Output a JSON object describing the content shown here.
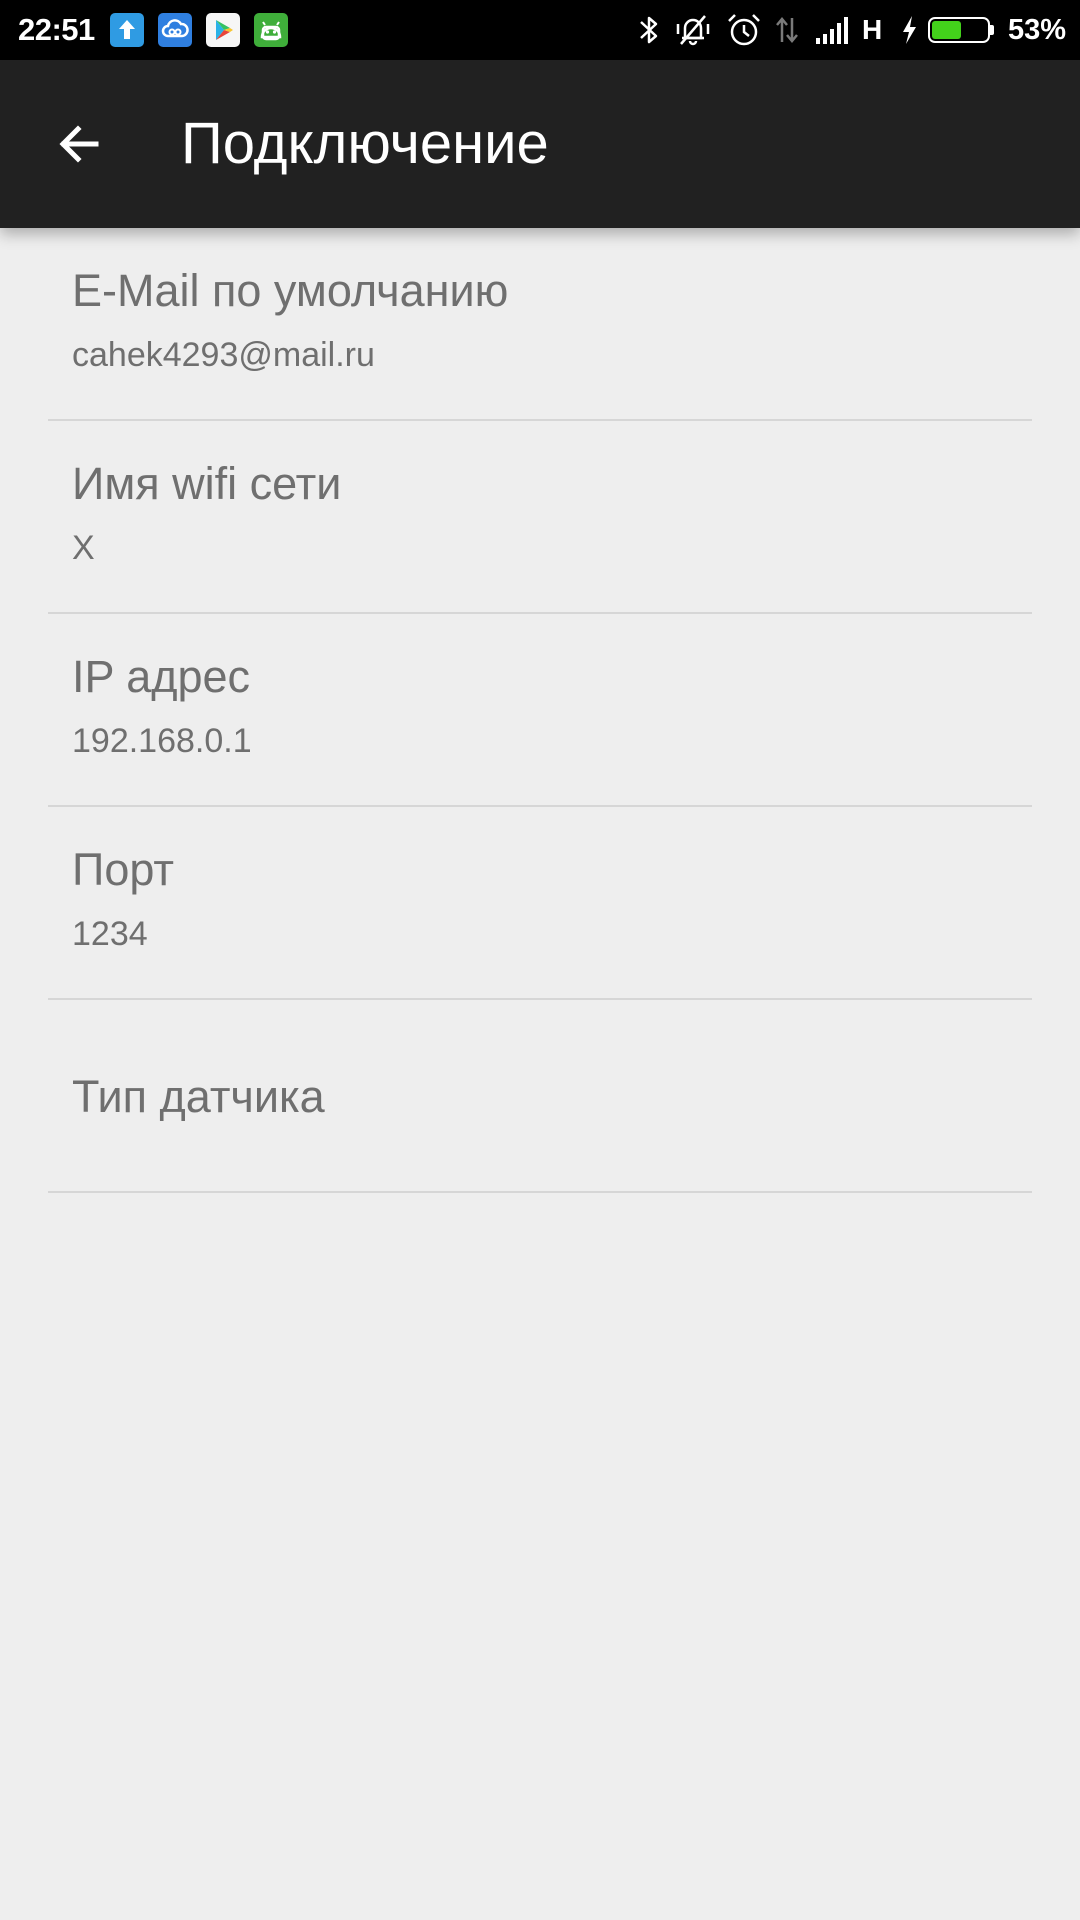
{
  "status_bar": {
    "time": "22:51",
    "network_type": "H",
    "battery_percent": "53%",
    "battery_level": 0.53,
    "notification_icons": [
      "upload-icon",
      "cloud-icon",
      "play-store-icon",
      "android-icon"
    ],
    "system_icons": [
      "bluetooth-icon",
      "silent-mode-icon",
      "alarm-icon",
      "data-activity-icon",
      "signal-icon",
      "charging-icon",
      "battery-icon"
    ],
    "battery_fill_color": "#43d11b"
  },
  "app_bar": {
    "back_icon": "arrow-back-icon",
    "title": "Подключение",
    "background": "#212121"
  },
  "settings": [
    {
      "title": "E-Mail по умолчанию",
      "summary": "cahek4293@mail.ru"
    },
    {
      "title": "Имя wifi сети",
      "summary": "X"
    },
    {
      "title": "IP адрес",
      "summary": "192.168.0.1"
    },
    {
      "title": "Порт",
      "summary": "1234"
    },
    {
      "title": "Тип датчика"
    }
  ]
}
